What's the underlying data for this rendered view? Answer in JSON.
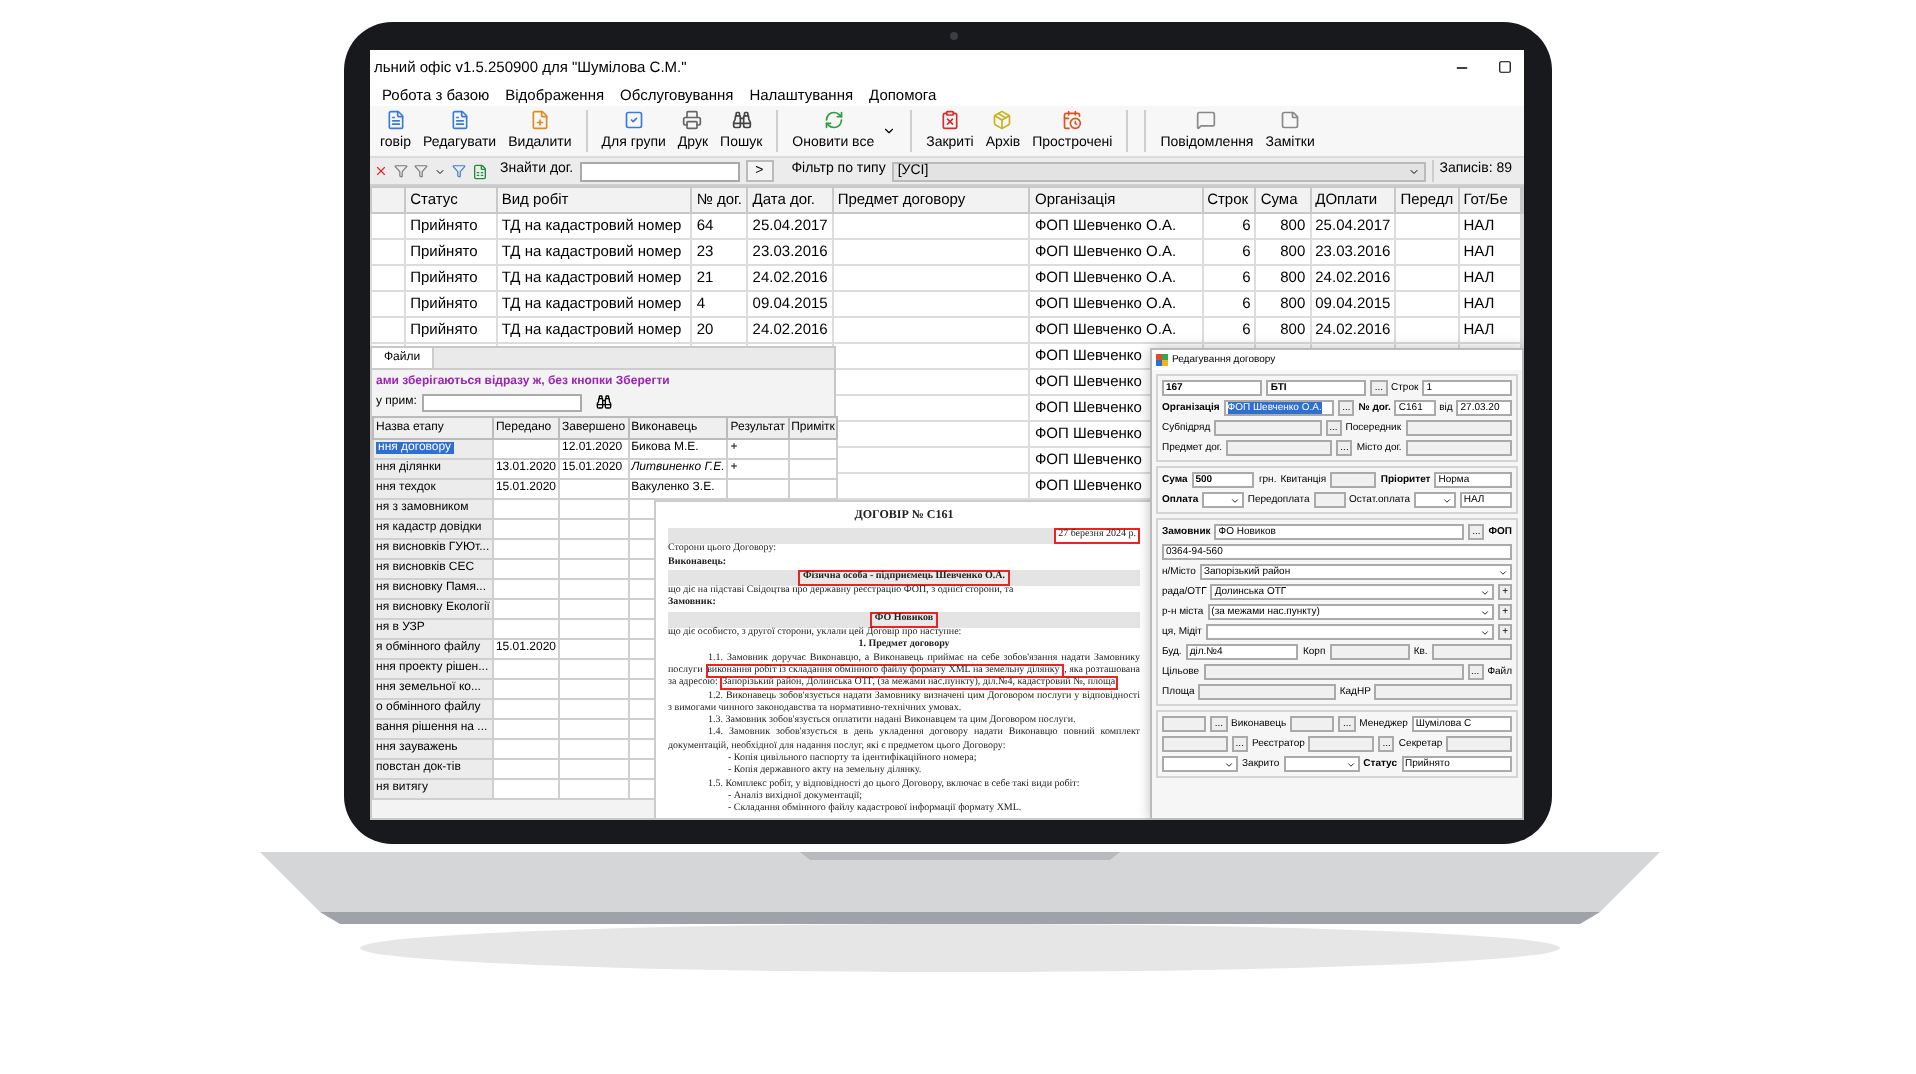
{
  "window": {
    "title": "льний офіс v1.5.250900 для \"Шумілова С.М.\""
  },
  "menu": [
    "Робота з базою",
    "Відображення",
    "Обслуговування",
    "Налаштування",
    "Допомога"
  ],
  "toolbar": [
    {
      "kind": "button",
      "label": "говір"
    },
    {
      "kind": "button",
      "label": "Редагувати"
    },
    {
      "kind": "button",
      "label": "Видалити"
    },
    {
      "kind": "separator"
    },
    {
      "kind": "button",
      "label": "Для групи"
    },
    {
      "kind": "button",
      "label": "Друк"
    },
    {
      "kind": "button",
      "label": "Пошук"
    },
    {
      "kind": "separator"
    },
    {
      "kind": "menu_button",
      "label": "Оновити все"
    },
    {
      "kind": "separator"
    },
    {
      "kind": "button",
      "label": "Закриті"
    },
    {
      "kind": "button",
      "label": "Архів"
    },
    {
      "kind": "button",
      "label": "Прострочені"
    },
    {
      "kind": "separator"
    },
    {
      "kind": "separator"
    },
    {
      "kind": "button",
      "label": "Повідомлення"
    },
    {
      "kind": "button",
      "label": "Замітки"
    }
  ],
  "filter_bar": {
    "find_label": "Знайти дог.",
    "go_button": ">",
    "filter_label": "Фільтр по типу",
    "filter_value": "[УСІ]",
    "count": "Записів: 89"
  },
  "table": {
    "columns": [
      "Статус",
      "Вид робіт",
      "№ дог.",
      "Дата дог.",
      "Предмет договору",
      "Організація",
      "Строк",
      "Сума",
      "ДОплати",
      "Передл",
      "Гот/Бе"
    ],
    "rows": [
      {
        "status": "Прийнято",
        "work": "ТД на кадастровий номер",
        "number": "64",
        "date": "25.04.2017",
        "organization": "ФОП Шевченко О.А.",
        "term": "6",
        "sum": "800",
        "pay_date": "25.04.2017",
        "pay_type": "НАЛ"
      },
      {
        "status": "Прийнято",
        "work": "ТД на кадастровий номер",
        "number": "23",
        "date": "23.03.2016",
        "organization": "ФОП Шевченко О.А.",
        "term": "6",
        "sum": "800",
        "pay_date": "23.03.2016",
        "pay_type": "НАЛ"
      },
      {
        "status": "Прийнято",
        "work": "ТД на кадастровий номер",
        "number": "21",
        "date": "24.02.2016",
        "organization": "ФОП Шевченко О.А.",
        "term": "6",
        "sum": "800",
        "pay_date": "24.02.2016",
        "pay_type": "НАЛ"
      },
      {
        "status": "Прийнято",
        "work": "ТД на кадастровий номер",
        "number": "4",
        "date": "09.04.2015",
        "organization": "ФОП Шевченко О.А.",
        "term": "6",
        "sum": "800",
        "pay_date": "09.04.2015",
        "pay_type": "НАЛ"
      },
      {
        "status": "Прийнято",
        "work": "ТД на кадастровий номер",
        "number": "20",
        "date": "24.02.2016",
        "organization": "ФОП Шевченко О.А.",
        "term": "6",
        "sum": "800",
        "pay_date": "24.02.2016",
        "pay_type": "НАЛ"
      }
    ],
    "partial_rows": [
      {
        "organization": "ФОП Шевченко"
      },
      {
        "organization": "ФОП Шевченко"
      },
      {
        "organization": "ФОП Шевченко"
      },
      {
        "organization": "ФОП Шевченко"
      },
      {
        "organization": "ФОП Шевченко"
      },
      {
        "organization": "ФОП Шевченко"
      }
    ]
  },
  "stages_panel": {
    "tabs": [
      {
        "label": "Файли",
        "selected": true
      }
    ],
    "note": "ами зберігаються відразу ж, без кнопки Зберегти",
    "search_label": "у прим:",
    "columns": [
      "Назва етапу",
      "Передано",
      "Завершено",
      "Виконавець",
      "Результат",
      "Примітк"
    ],
    "rows": [
      {
        "name": "ння договору",
        "done": "12.01.2020",
        "executor": "Бикова М.Е.",
        "result": "+",
        "selected": true
      },
      {
        "name": "ння ділянки",
        "passed": "13.01.2020",
        "done": "15.01.2020",
        "executor": "Литвиненко Г.Е.",
        "result": "+",
        "selected": false
      },
      {
        "name": "ння техдок",
        "passed": "15.01.2020",
        "executor": "Вакуленко З.Е.",
        "selected": false
      },
      {
        "name": "ня з замовником",
        "selected": false
      },
      {
        "name": "ня кадастр довідки",
        "selected": false
      },
      {
        "name": "ня висновків ГУЮт...",
        "selected": false
      },
      {
        "name": "ня висновків СЕС",
        "selected": false
      },
      {
        "name": "ня висновку Памя...",
        "selected": false
      },
      {
        "name": "ня висновку Екології",
        "selected": false
      },
      {
        "name": "ня в УЗР",
        "selected": false
      },
      {
        "name": "я обмінного файлу",
        "passed": "15.01.2020",
        "selected": false
      },
      {
        "name": "ння проекту рішен...",
        "selected": false
      },
      {
        "name": "ння земельної ко...",
        "selected": false
      },
      {
        "name": "о обмінного файлу",
        "selected": false
      },
      {
        "name": "вання рішення на ...",
        "selected": false
      },
      {
        "name": "ння зауважень",
        "selected": false
      },
      {
        "name": "повстан док-тів",
        "selected": false
      },
      {
        "name": "ня витягу",
        "selected": false
      }
    ]
  },
  "document": {
    "title": "ДОГОВІР № С161",
    "date": "27 березня 2024 р.",
    "blocks": [
      {
        "kind": "text",
        "text": "Сторони цього Договору:"
      },
      {
        "kind": "heading",
        "text": "Виконавець:"
      },
      {
        "kind": "boxed",
        "text": "Фізична особа - підприємець Шевченко О.А."
      },
      {
        "kind": "text",
        "text": "що діє на підставі Свідоцтва про державну реєстрацію ФОП, з однієї сторони, та"
      },
      {
        "kind": "heading",
        "text": "Замовник:"
      },
      {
        "kind": "boxed",
        "text": "ФО Новиков"
      },
      {
        "kind": "text",
        "text": "що діє особисто, з другої сторони, уклали цей Договір про наступне:"
      },
      {
        "kind": "center",
        "text": "1. Предмет договору"
      },
      {
        "kind": "para",
        "parts": [
          {
            "text": "1.1. Замовник доручає Виконавцю, а Виконавець приймає на себе зобов'язання надати Замовнику послуги",
            "boxed": false
          },
          {
            "text": "виконання робіт із складання обмінного файлу формату XML на земельну ділянку",
            "boxed": true
          },
          {
            "text": ", яка розташована за адресою:",
            "boxed": false
          },
          {
            "text": "Запорізький район, Долинська ОТГ, (за межами нас.пункту), діл.№4, кадастровий №, площа",
            "boxed": true
          }
        ]
      },
      {
        "kind": "para",
        "parts": [
          {
            "text": "1.2. Виконавець зобов'язується надати Замовнику визначені цим Договором послуги у відповідності з вимогами чинного законодавства та нормативно-технічних умовах.",
            "boxed": false
          }
        ]
      },
      {
        "kind": "para",
        "parts": [
          {
            "text": "1.3. Замовник зобов'язується оплатити надані Виконавцем та цим Договором послуги.",
            "boxed": false
          }
        ]
      },
      {
        "kind": "para",
        "parts": [
          {
            "text": "1.4. Замовник зобов'язується в день укладення договору надати Виконавцю повний комплект документацій, необхідної для надання послуг, які є предметом цього Договору:",
            "boxed": false
          }
        ]
      },
      {
        "kind": "item",
        "text": "- Копія цивільного паспорту та ідентифікаційного номера;"
      },
      {
        "kind": "item",
        "text": "- Копія державного акту на земельну ділянку."
      },
      {
        "kind": "para",
        "parts": [
          {
            "text": "1.5. Комплекс робіт, у відповідності до цього Договору, включає в себе такі види робіт:",
            "boxed": false
          }
        ]
      },
      {
        "kind": "item",
        "text": "- Аналіз вихідної документації;"
      },
      {
        "kind": "item",
        "text": "- Складання обмінного файлу кадастрової інформації формату XML."
      }
    ]
  },
  "edit_dialog": {
    "title": "Редагування договору",
    "sections": [
      [
        [
          {
            "kind": "field",
            "value": "167",
            "bold": true
          },
          {
            "kind": "field",
            "value": "БТІ",
            "bold": true
          },
          {
            "kind": "dots",
            "text": "..."
          },
          {
            "kind": "label",
            "text": "Строк",
            "bold": false
          },
          {
            "kind": "field",
            "value": "1",
            "bold": false
          }
        ],
        [
          {
            "kind": "label",
            "text": "Організація",
            "bold": true
          },
          {
            "kind": "field",
            "value": "ФОП Шевченко О.А.",
            "bold": false,
            "highlighted": true
          },
          {
            "kind": "dots",
            "text": "..."
          },
          {
            "kind": "label",
            "text": "№ дог.",
            "bold": true
          },
          {
            "kind": "field",
            "value": "С161",
            "bold": false
          },
          {
            "kind": "label",
            "text": "від",
            "bold": false
          },
          {
            "kind": "field",
            "value": "27.03.20",
            "bold": false
          }
        ],
        [
          {
            "kind": "label",
            "text": "Субпідряд",
            "bold": false
          },
          {
            "kind": "field"
          },
          {
            "kind": "dots",
            "text": "..."
          },
          {
            "kind": "label",
            "text": "Посередник",
            "bold": false
          },
          {
            "kind": "field"
          }
        ],
        [
          {
            "kind": "label",
            "text": "Предмет дог.",
            "bold": false
          },
          {
            "kind": "field"
          },
          {
            "kind": "dots",
            "text": "..."
          },
          {
            "kind": "label",
            "text": "Місто дог.",
            "bold": false
          },
          {
            "kind": "field"
          }
        ]
      ],
      [
        [
          {
            "kind": "label",
            "text": "Сума",
            "bold": true
          },
          {
            "kind": "field",
            "value": "500",
            "bold": true
          },
          {
            "kind": "label",
            "text": "грн.",
            "bold": false
          },
          {
            "kind": "label",
            "text": "Квитанція",
            "bold": false
          },
          {
            "kind": "field"
          },
          {
            "kind": "label",
            "text": "Пріоритет",
            "bold": true
          },
          {
            "kind": "field",
            "value": "Норма",
            "bold": false
          }
        ],
        [
          {
            "kind": "label",
            "text": "Оплата",
            "bold": true
          },
          {
            "kind": "select"
          },
          {
            "kind": "label",
            "text": "Передоплата",
            "bold": false
          },
          {
            "kind": "field"
          },
          {
            "kind": "label",
            "text": "Остат.оплата",
            "bold": false
          },
          {
            "kind": "select"
          },
          {
            "kind": "field",
            "value": "НАЛ",
            "bold": false
          }
        ]
      ],
      [
        [
          {
            "kind": "label",
            "text": "Замовник",
            "bold": true
          },
          {
            "kind": "field",
            "value": "ФО Новиков",
            "bold": false
          },
          {
            "kind": "dots",
            "text": "..."
          },
          {
            "kind": "label",
            "text": "ФОП",
            "bold": true
          }
        ],
        [
          {
            "kind": "field",
            "value": "0364-94-560",
            "bold": false
          }
        ],
        [
          {
            "kind": "label",
            "text": "н/Місто",
            "bold": false
          },
          {
            "kind": "select",
            "value": "Запорізький район"
          }
        ],
        [
          {
            "kind": "label",
            "text": "рада/ОТГ",
            "bold": false
          },
          {
            "kind": "select",
            "value": "Долинська ОТГ"
          },
          {
            "kind": "dots",
            "text": "+"
          }
        ],
        [
          {
            "kind": "label",
            "text": "р-н міста",
            "bold": false
          },
          {
            "kind": "select",
            "value": "(за межами нас.пункту)"
          },
          {
            "kind": "dots",
            "text": "+"
          }
        ],
        [
          {
            "kind": "label",
            "text": "ця, Мідіт",
            "bold": false
          },
          {
            "kind": "select"
          },
          {
            "kind": "dots",
            "text": "+"
          }
        ],
        [
          {
            "kind": "label",
            "text": "Буд.",
            "bold": false
          },
          {
            "kind": "field",
            "value": "діл.№4",
            "bold": false
          },
          {
            "kind": "label",
            "text": "Корп",
            "bold": false
          },
          {
            "kind": "field"
          },
          {
            "kind": "label",
            "text": "Кв.",
            "bold": false
          },
          {
            "kind": "field"
          }
        ],
        [
          {
            "kind": "label",
            "text": "Цільове",
            "bold": false
          },
          {
            "kind": "field"
          },
          {
            "kind": "dots",
            "text": "..."
          },
          {
            "kind": "label",
            "text": "Файл",
            "bold": false
          }
        ],
        [
          {
            "kind": "label",
            "text": "Площа",
            "bold": false
          },
          {
            "kind": "field"
          },
          {
            "kind": "label",
            "text": "КадНР",
            "bold": false
          },
          {
            "kind": "field"
          }
        ]
      ],
      [
        [
          {
            "kind": "field"
          },
          {
            "kind": "dots",
            "text": "..."
          },
          {
            "kind": "label",
            "text": "Виконавець",
            "bold": false
          },
          {
            "kind": "field"
          },
          {
            "kind": "dots",
            "text": "..."
          },
          {
            "kind": "label",
            "text": "Менеджер",
            "bold": false
          },
          {
            "kind": "field",
            "value": "Шумілова С",
            "bold": false
          }
        ],
        [
          {
            "kind": "field"
          },
          {
            "kind": "dots",
            "text": "..."
          },
          {
            "kind": "label",
            "text": "Реєстратор",
            "bold": false
          },
          {
            "kind": "field"
          },
          {
            "kind": "dots",
            "text": "..."
          },
          {
            "kind": "label",
            "text": "Секретар",
            "bold": false
          },
          {
            "kind": "field"
          }
        ],
        [
          {
            "kind": "select"
          },
          {
            "kind": "label",
            "text": "Закрито",
            "bold": false
          },
          {
            "kind": "select"
          },
          {
            "kind": "label",
            "text": "Статус",
            "bold": true
          },
          {
            "kind": "field",
            "value": "Прийнято",
            "bold": false
          }
        ]
      ]
    ]
  }
}
